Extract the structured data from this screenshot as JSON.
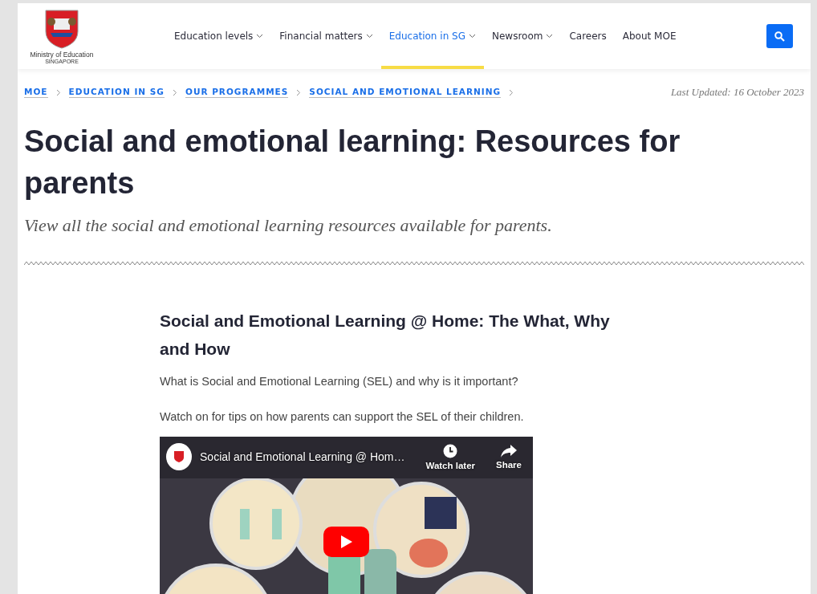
{
  "header": {
    "logo": {
      "name": "Ministry of Education",
      "country": "SINGAPORE"
    },
    "nav": [
      {
        "label": "Education levels",
        "dropdown": true,
        "selected": false
      },
      {
        "label": "Financial matters",
        "dropdown": true,
        "selected": false
      },
      {
        "label": "Education in SG",
        "dropdown": true,
        "selected": true
      },
      {
        "label": "Newsroom",
        "dropdown": true,
        "selected": false
      },
      {
        "label": "Careers",
        "dropdown": false,
        "selected": false
      },
      {
        "label": "About MOE",
        "dropdown": false,
        "selected": false
      }
    ]
  },
  "breadcrumb": {
    "items": [
      "MOE",
      "EDUCATION IN SG",
      "OUR PROGRAMMES",
      "SOCIAL AND EMOTIONAL LEARNING"
    ],
    "last_updated": "Last Updated: 16 October 2023"
  },
  "hero": {
    "title": "Social and emotional learning: Resources for parents",
    "subtitle": "View all the social and emotional learning resources available for parents."
  },
  "article": {
    "heading": "Social and Emotional Learning @ Home: The What, Why and How",
    "paragraphs": [
      "What is Social and Emotional Learning (SEL) and why is it important?",
      "Watch on for tips on how parents can support the SEL of their children."
    ],
    "video": {
      "kind": "picture",
      "title": "Social and Emotional Learning @ Hom…",
      "actions": [
        {
          "kind": "clock",
          "label": "Watch later"
        },
        {
          "kind": "share",
          "label": "Share"
        }
      ]
    }
  }
}
